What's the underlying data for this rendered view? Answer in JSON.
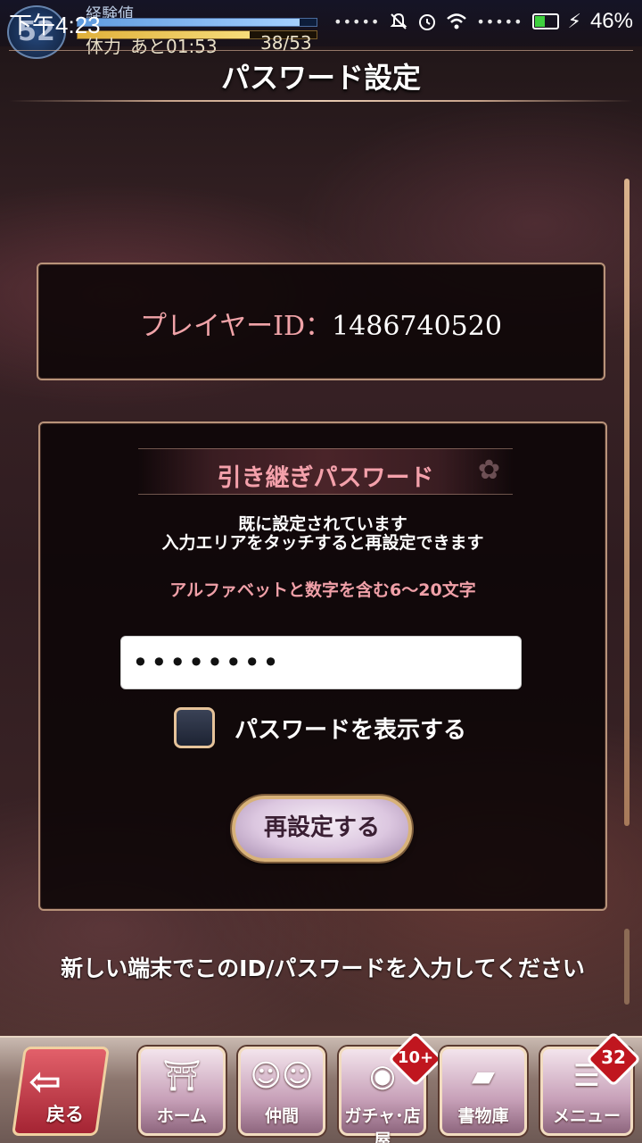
{
  "status_bar": {
    "time": "下午4:23",
    "battery_percent": "46%",
    "battery_level": 0.46,
    "level": "52",
    "exp_label": "経験値",
    "exp_fraction": 0.93,
    "stamina_label": "体力",
    "stamina_timer": "あと01:53",
    "stamina_value": "38/53",
    "stamina_fraction": 0.72,
    "icons": [
      "notifications-off-icon",
      "alarm-icon",
      "wifi-icon",
      "charging-icon"
    ]
  },
  "header": {
    "title": "パスワード設定"
  },
  "player": {
    "id_label": "プレイヤーID：",
    "id_value": "1486740520"
  },
  "password_panel": {
    "heading": "引き継ぎパスワード",
    "info_line1": "既に設定されています",
    "info_line2": "入力エリアをタッチすると再設定できます",
    "rule": "アルファベットと数字を含む6〜20文字",
    "input_value": "••••••••",
    "show_password_label": "パスワードを表示する",
    "show_password_checked": false,
    "reset_button": "再設定する"
  },
  "footer_note": "新しい端末でこのID/パスワードを入力してください",
  "nav": {
    "back": "戻る",
    "home": "ホーム",
    "party": "仲間",
    "gacha": "ガチャ･店屋",
    "gacha_badge": "10+",
    "library": "書物庫",
    "menu": "メニュー",
    "menu_badge": "32"
  },
  "colors": {
    "accent_pink": "#f0a3a8",
    "panel_border": "#b8937a",
    "badge_red": "#c0161f"
  }
}
